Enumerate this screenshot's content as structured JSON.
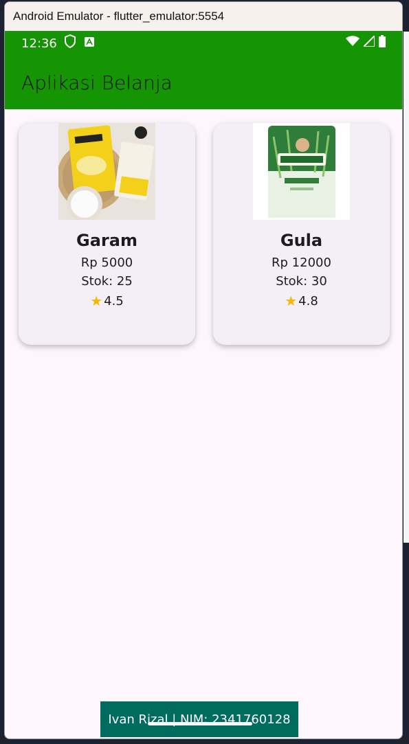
{
  "window": {
    "title": "Android Emulator - flutter_emulator:5554"
  },
  "statusbar": {
    "time": "12:36",
    "left_icons": [
      "shield-icon",
      "a-icon"
    ],
    "right_icons": [
      "wifi-icon",
      "signal-icon",
      "battery-icon"
    ]
  },
  "appbar": {
    "title": "Aplikasi Belanja",
    "color": "#169504"
  },
  "products": [
    {
      "name": "Garam",
      "price": "Rp 5000",
      "stock": "Stok: 25",
      "rating": "4.5"
    },
    {
      "name": "Gula",
      "price": "Rp 12000",
      "stock": "Stok: 30",
      "rating": "4.8"
    }
  ],
  "footer": {
    "text": "Ivan Rizal | NIM: 2341760128",
    "color": "#006b5f"
  }
}
